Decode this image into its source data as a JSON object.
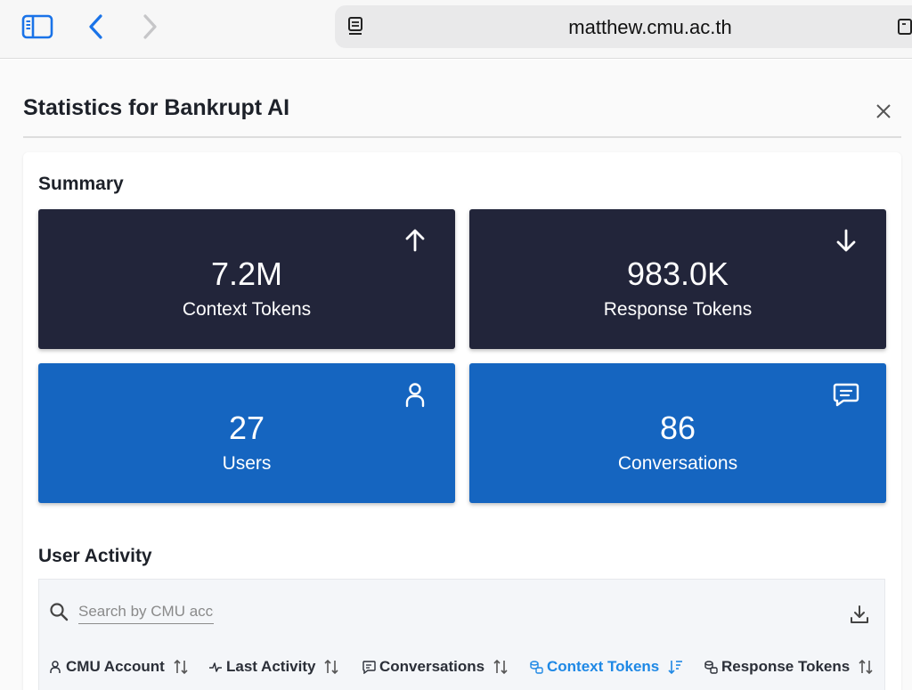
{
  "browser": {
    "url": "matthew.cmu.ac.th"
  },
  "modal": {
    "title": "Statistics for Bankrupt AI"
  },
  "summary": {
    "title": "Summary",
    "cards": [
      {
        "value": "7.2M",
        "label": "Context Tokens",
        "icon": "arrow-up-icon"
      },
      {
        "value": "983.0K",
        "label": "Response Tokens",
        "icon": "arrow-down-icon"
      },
      {
        "value": "27",
        "label": "Users",
        "icon": "user-icon"
      },
      {
        "value": "86",
        "label": "Conversations",
        "icon": "chat-icon"
      }
    ]
  },
  "activity": {
    "title": "User Activity",
    "search_placeholder": "Search by CMU account",
    "columns": [
      {
        "label": "CMU Account",
        "icon": "user-icon",
        "sorted": false
      },
      {
        "label": "Last Activity",
        "icon": "activity-icon",
        "sorted": false
      },
      {
        "label": "Conversations",
        "icon": "chat-icon",
        "sorted": false
      },
      {
        "label": "Context Tokens",
        "icon": "coins-icon",
        "sorted": true
      },
      {
        "label": "Response Tokens",
        "icon": "coins-icon",
        "sorted": false
      }
    ]
  },
  "colors": {
    "dark_card": "#22253a",
    "blue_card": "#1565c0",
    "active_column": "#1e88e5",
    "browser_accent": "#1a73e8"
  }
}
